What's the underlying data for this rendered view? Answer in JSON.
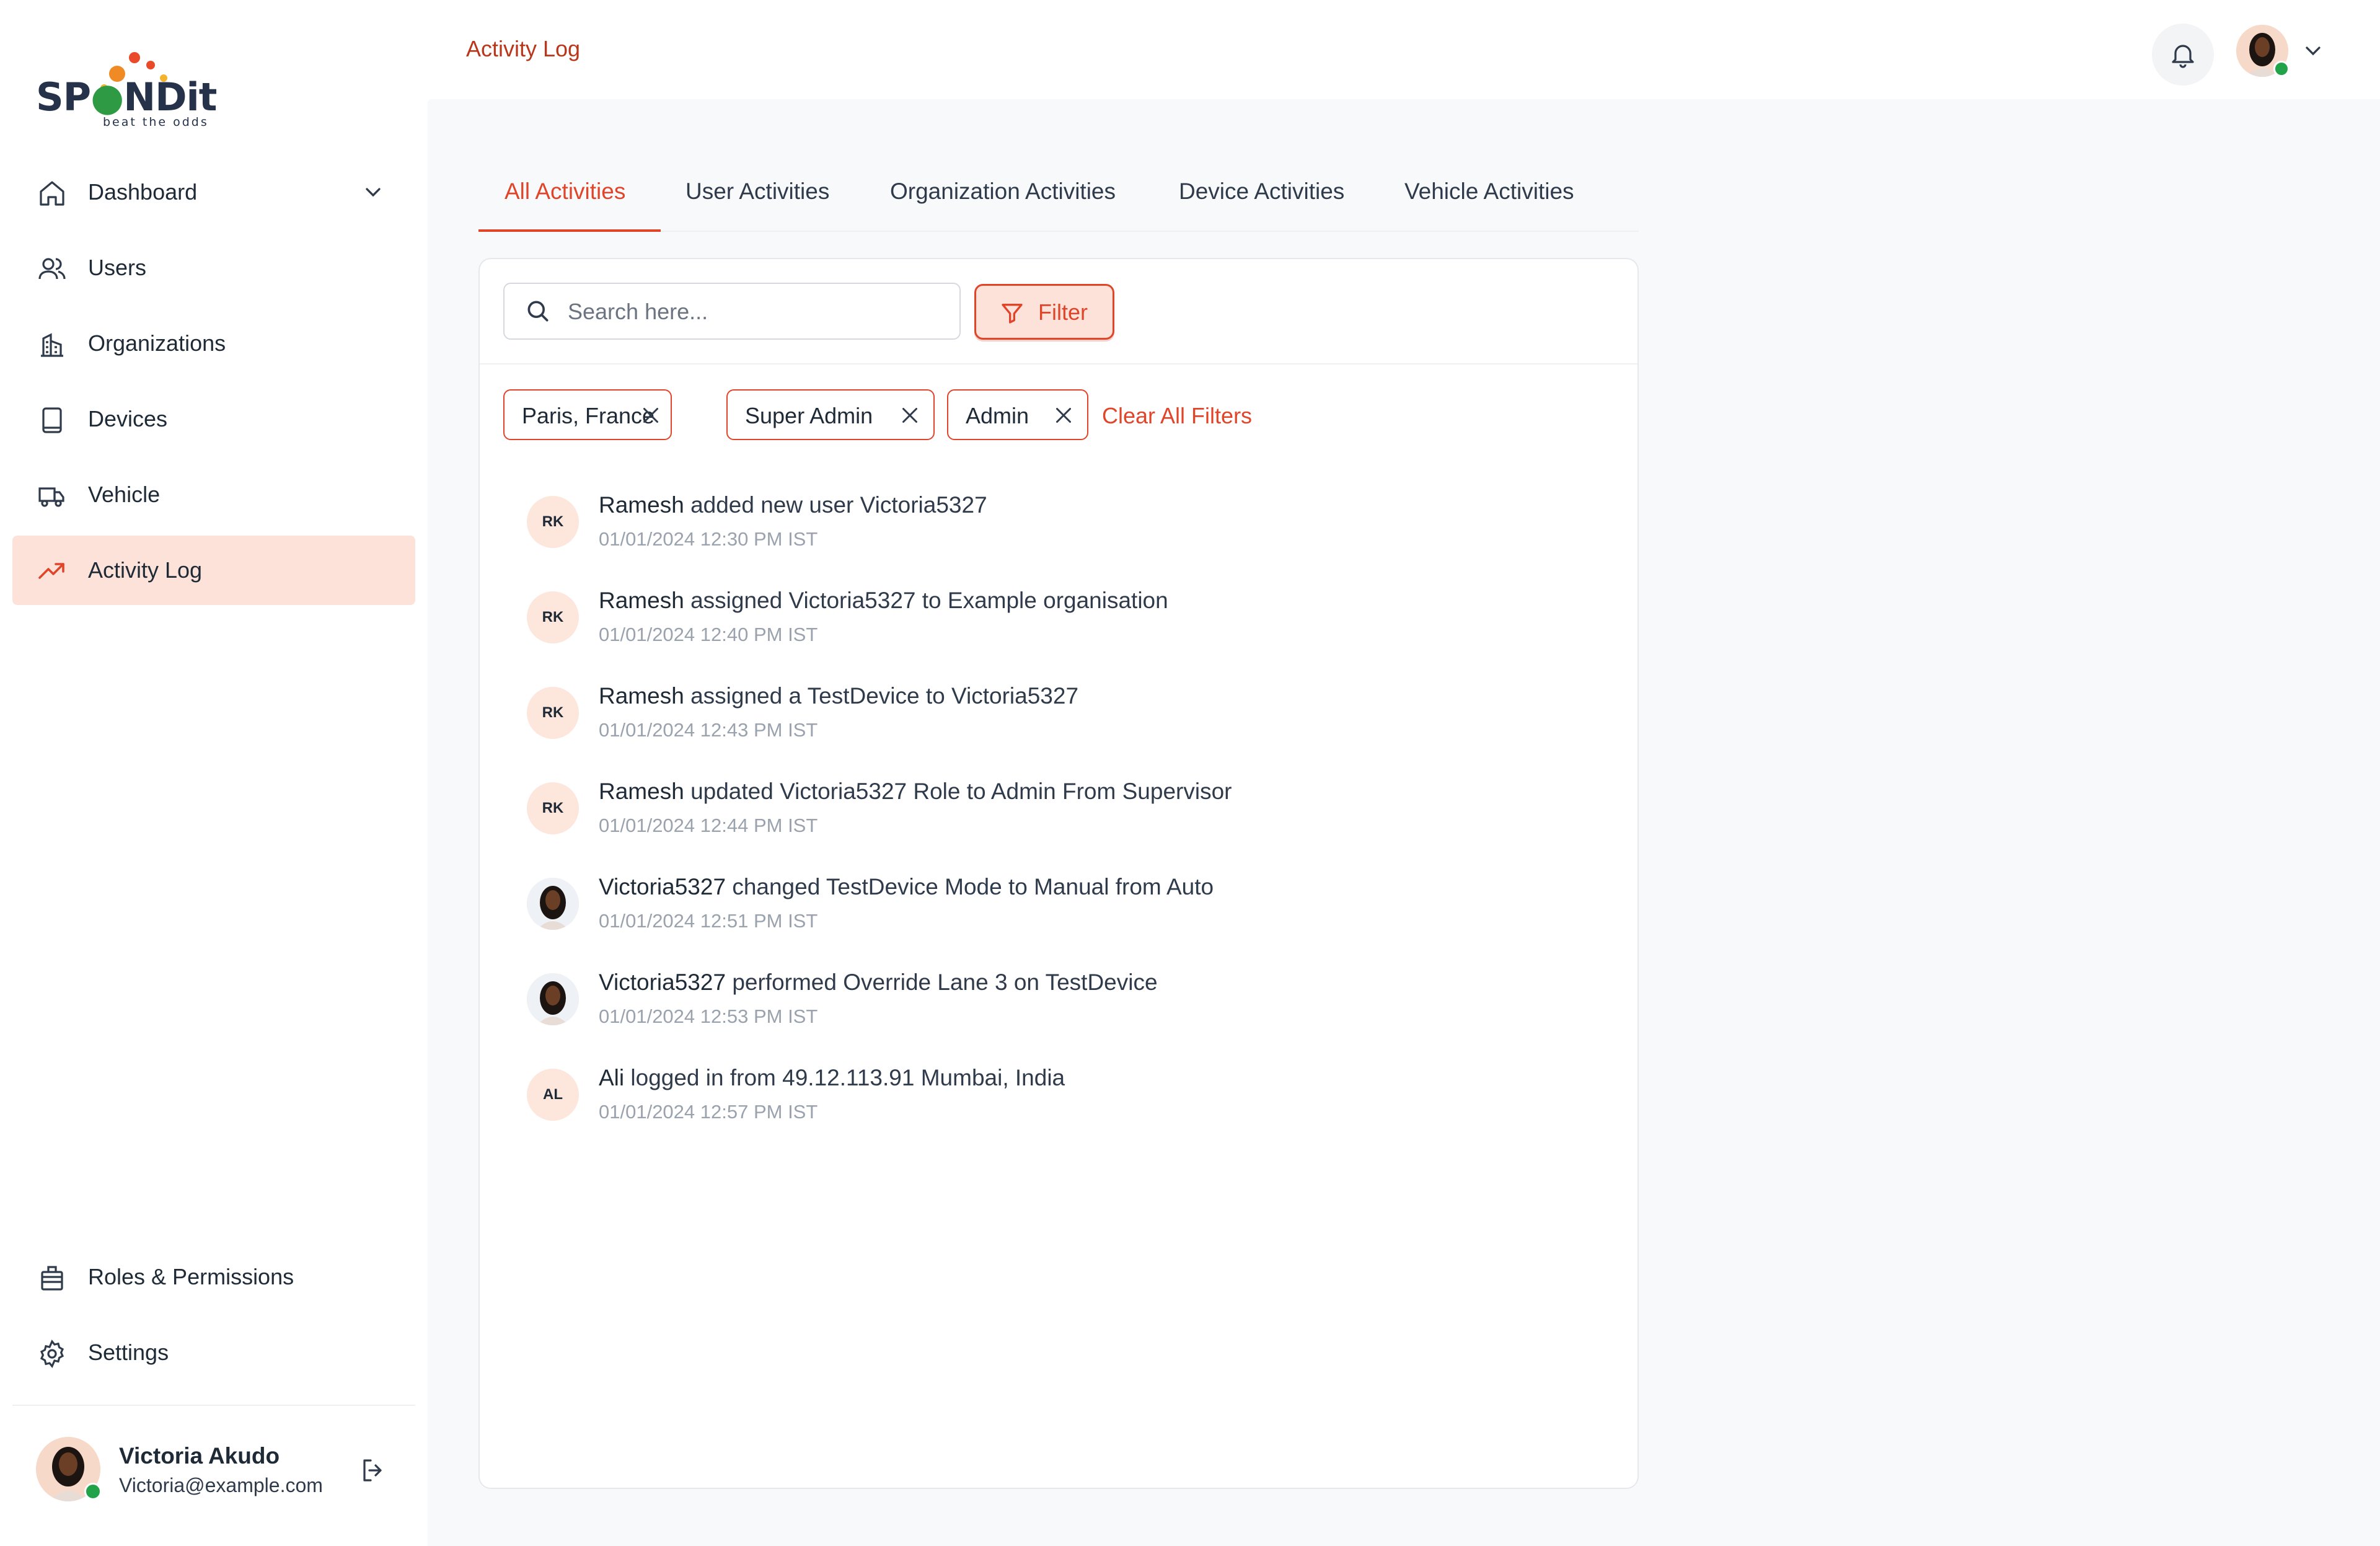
{
  "app": {
    "logo_text": "SPONDit",
    "logo_tagline": "beat the odds",
    "accent_color": "#e0452a",
    "active_bg_color": "#fde2da"
  },
  "header": {
    "breadcrumb": "Activity Log",
    "notification_icon": "bell-icon",
    "profile_dropdown_icon": "chevron-down-icon"
  },
  "sidebar": {
    "items": [
      {
        "label": "Dashboard",
        "icon": "home-icon",
        "has_chevron": true
      },
      {
        "label": "Users",
        "icon": "users-icon"
      },
      {
        "label": "Organizations",
        "icon": "building-icon"
      },
      {
        "label": "Devices",
        "icon": "device-icon"
      },
      {
        "label": "Vehicle",
        "icon": "truck-icon"
      },
      {
        "label": "Activity Log",
        "icon": "trend-icon",
        "active": true
      }
    ],
    "bottom_items": [
      {
        "label": "Roles & Permissions",
        "icon": "briefcase-icon"
      },
      {
        "label": "Settings",
        "icon": "gear-icon"
      }
    ],
    "user": {
      "name": "Victoria Akudo",
      "email": "Victoria@example.com",
      "logout_icon": "logout-icon"
    }
  },
  "tabs": [
    {
      "label": "All Activities",
      "active": true
    },
    {
      "label": "User Activities"
    },
    {
      "label": "Organization Activities"
    },
    {
      "label": "Device Activities"
    },
    {
      "label": "Vehicle Activities"
    }
  ],
  "search": {
    "placeholder": "Search here...",
    "value": ""
  },
  "filter_button": {
    "label": "Filter"
  },
  "active_filters": [
    {
      "label": "Paris, France"
    },
    {
      "label": "Super Admin"
    },
    {
      "label": "Admin"
    }
  ],
  "clear_filters_label": "Clear All Filters",
  "activities": [
    {
      "initials": "RK",
      "actor": "Ramesh",
      "action": "added new user Victoria5327",
      "time": "01/01/2024 12:30 PM IST"
    },
    {
      "initials": "RK",
      "actor": "Ramesh",
      "action": "assigned Victoria5327 to Example organisation",
      "time": "01/01/2024 12:40 PM IST"
    },
    {
      "initials": "RK",
      "actor": "Ramesh",
      "action": "assigned a TestDevice to Victoria5327",
      "time": "01/01/2024 12:43 PM IST"
    },
    {
      "initials": "RK",
      "actor": "Ramesh",
      "action": "updated Victoria5327 Role to Admin From Supervisor",
      "time": "01/01/2024 12:44 PM IST"
    },
    {
      "initials": "",
      "photo": true,
      "actor": "Victoria5327",
      "action": "changed TestDevice Mode to Manual from Auto",
      "time": "01/01/2024 12:51 PM IST"
    },
    {
      "initials": "",
      "photo": true,
      "actor": "Victoria5327",
      "action": "performed Override Lane 3 on TestDevice",
      "time": "01/01/2024 12:53 PM IST"
    },
    {
      "initials": "AL",
      "actor": "Ali",
      "action": "logged in from 49.12.113.91 Mumbai, India",
      "time": "01/01/2024 12:57 PM IST"
    }
  ]
}
